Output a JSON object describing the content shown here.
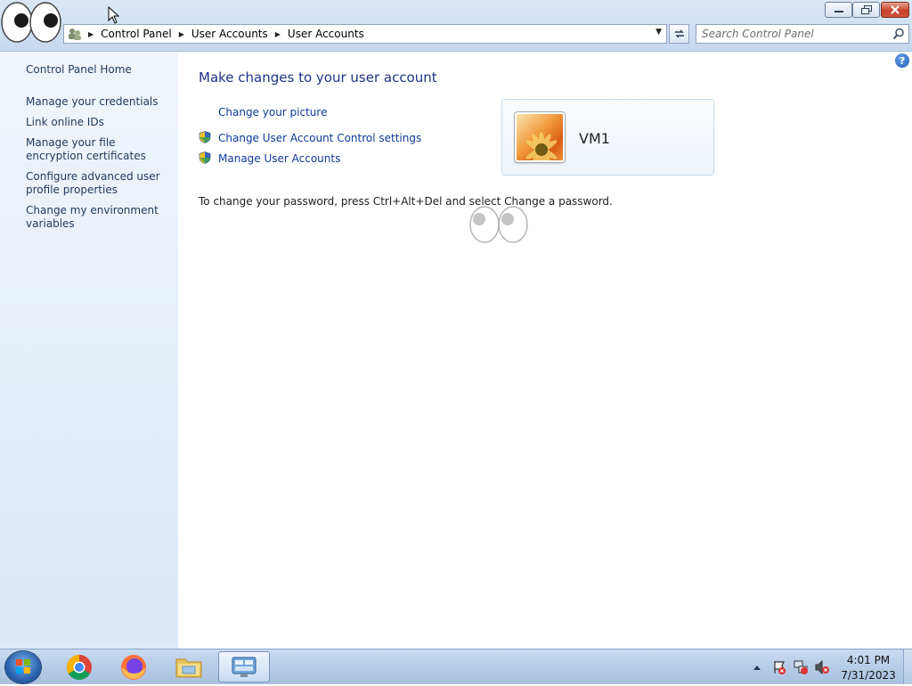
{
  "window": {
    "breadcrumb": [
      "Control Panel",
      "User Accounts",
      "User Accounts"
    ],
    "search_placeholder": "Search Control Panel"
  },
  "sidebar": {
    "home": "Control Panel Home",
    "items": [
      {
        "label": "Manage your credentials"
      },
      {
        "label": "Link online IDs"
      },
      {
        "label": "Manage your file encryption certificates"
      },
      {
        "label": "Configure advanced user profile properties"
      },
      {
        "label": "Change my environment variables"
      }
    ]
  },
  "main": {
    "title": "Make changes to your user account",
    "tasks": [
      {
        "label": "Change your picture",
        "icon": "none"
      },
      {
        "label": "Change User Account Control settings",
        "icon": "uac-shield-icon"
      },
      {
        "label": "Manage User Accounts",
        "icon": "uac-shield-icon"
      }
    ],
    "account": {
      "name": "VM1",
      "picture": "orange-flower"
    },
    "password_hint": "To change your password, press Ctrl+Alt+Del and select Change a password.",
    "help_glyph": "?"
  },
  "taskbar": {
    "items": [
      "start-orb",
      "chrome",
      "firefox",
      "file-explorer",
      "control-panel"
    ],
    "active_item": "control-panel",
    "clock": {
      "time": "4:01 PM",
      "date": "7/31/2023"
    }
  },
  "colors": {
    "link": "#0b3a9c",
    "heading": "#1e3287",
    "nav_link": "#1e395b",
    "titlebar": "#cfdff2",
    "taskbar": "#b6cce6"
  }
}
